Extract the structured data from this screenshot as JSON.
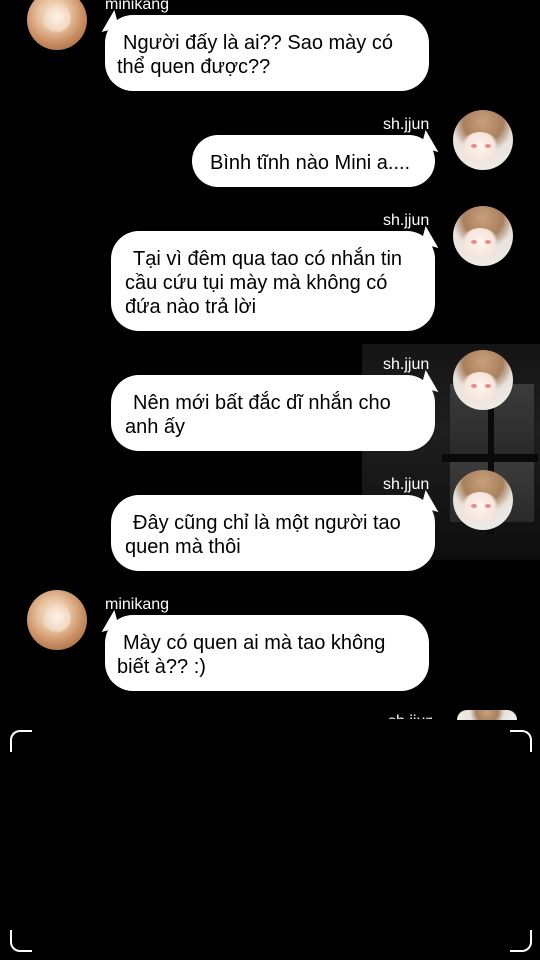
{
  "users": {
    "left_name": "minikang",
    "right_name": "sh.jjun"
  },
  "messages": [
    {
      "sender": "minikang",
      "side": "left",
      "lines": [
        "Người đấy là ai?? Sao mày có",
        "thể quen được??"
      ]
    },
    {
      "sender": "sh.jjun",
      "side": "right",
      "lines": [
        "Bình tĩnh nào Mini a...."
      ]
    },
    {
      "sender": "sh.jjun",
      "side": "right",
      "lines": [
        "Tại vì đêm qua tao có nhắn tin",
        "cầu cứu tụi mày mà không có",
        "đứa nào trả lời"
      ]
    },
    {
      "sender": "sh.jjun",
      "side": "right",
      "lines": [
        "Nên mới bất đắc dĩ nhắn cho",
        "anh ấy"
      ]
    },
    {
      "sender": "sh.jjun",
      "side": "right",
      "lines": [
        "Đây cũng chỉ là một người tao",
        "quen mà thôi"
      ]
    },
    {
      "sender": "minikang",
      "side": "left",
      "lines": [
        "Mày có quen ai mà tao không",
        "biết à?? :)"
      ]
    }
  ]
}
